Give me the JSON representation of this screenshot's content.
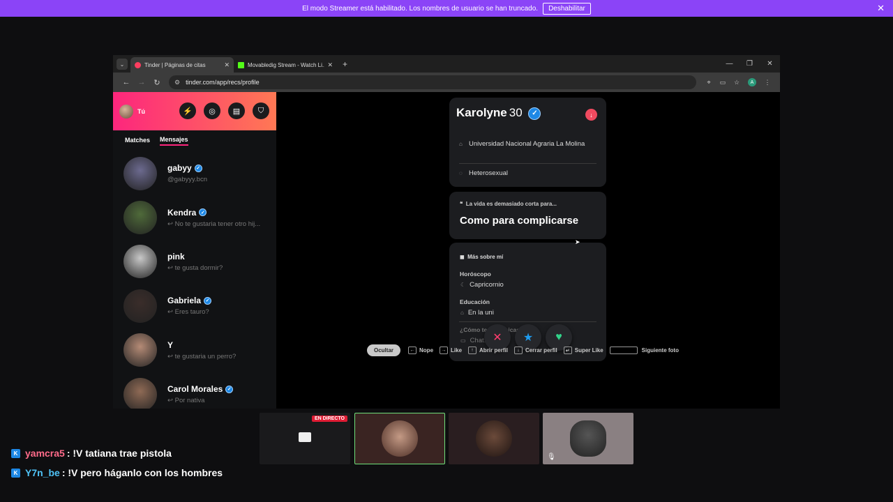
{
  "banner": {
    "text": "El modo Streamer está habilitado. Los nombres de usuario se han truncado.",
    "button": "Deshabilitar",
    "close": "✕"
  },
  "browser": {
    "tabs": [
      {
        "title": "Tinder | Páginas de citas",
        "color": "#fd3d5f"
      },
      {
        "title": "Movabledig Stream - Watch Li...",
        "color": "#53fc18"
      }
    ],
    "url": "tinder.com/app/recs/profile",
    "profile_initial": "A"
  },
  "sidebar": {
    "me_label": "Tú",
    "tabs": [
      "Matches",
      "Mensajes"
    ],
    "conversations": [
      {
        "name": "gabyy",
        "message": "@gabyyy.bcn",
        "verified": true,
        "reply": false,
        "color": "#6c6a8f"
      },
      {
        "name": "Kendra",
        "message": "No te gustaria tener otro hij...",
        "verified": true,
        "reply": true,
        "color": "#4f6a3a"
      },
      {
        "name": "pink",
        "message": "te gusta dormir?",
        "verified": false,
        "reply": true,
        "color": "#c8c8c8"
      },
      {
        "name": "Gabriela",
        "message": "Eres tauro?",
        "verified": true,
        "reply": true,
        "color": "#3a2d2a"
      },
      {
        "name": "Y",
        "message": "te gustaria un perro?",
        "verified": false,
        "reply": true,
        "color": "#b58b76"
      },
      {
        "name": "Carol Morales",
        "message": "Por nativa",
        "verified": true,
        "reply": true,
        "color": "#8f6a55"
      }
    ]
  },
  "profile": {
    "name": "Karolyne",
    "age": "30",
    "university": "Universidad Nacional Agraria La Molina",
    "orientation": "Heterosexual",
    "quote_prompt": "La vida es demasiado corta para...",
    "quote_answer": "Como para complicarse",
    "more_heading": "Más sobre mí",
    "horoscope_label": "Horóscopo",
    "horoscope_value": "Capricornio",
    "education_label": "Educación",
    "education_value": "En la uni",
    "partial_label": "¿Cómo te comunicas?",
    "partial_value": "Chat..."
  },
  "shortcuts": {
    "hide": "Ocultar",
    "nope": "Nope",
    "like": "Like",
    "open": "Abrir perfil",
    "close": "Cerrar perfil",
    "superlike": "Super Like",
    "next": "Siguiente foto"
  },
  "cams": {
    "live_label": "EN DIRECTO"
  },
  "chat": [
    {
      "user": "yamcra5",
      "text": ": !V tatiana trae pistola",
      "color": "#ff6b8a"
    },
    {
      "user": "Y7n_be",
      "text": ": !V pero háganlo con los hombres",
      "color": "#4fc3f7"
    }
  ]
}
